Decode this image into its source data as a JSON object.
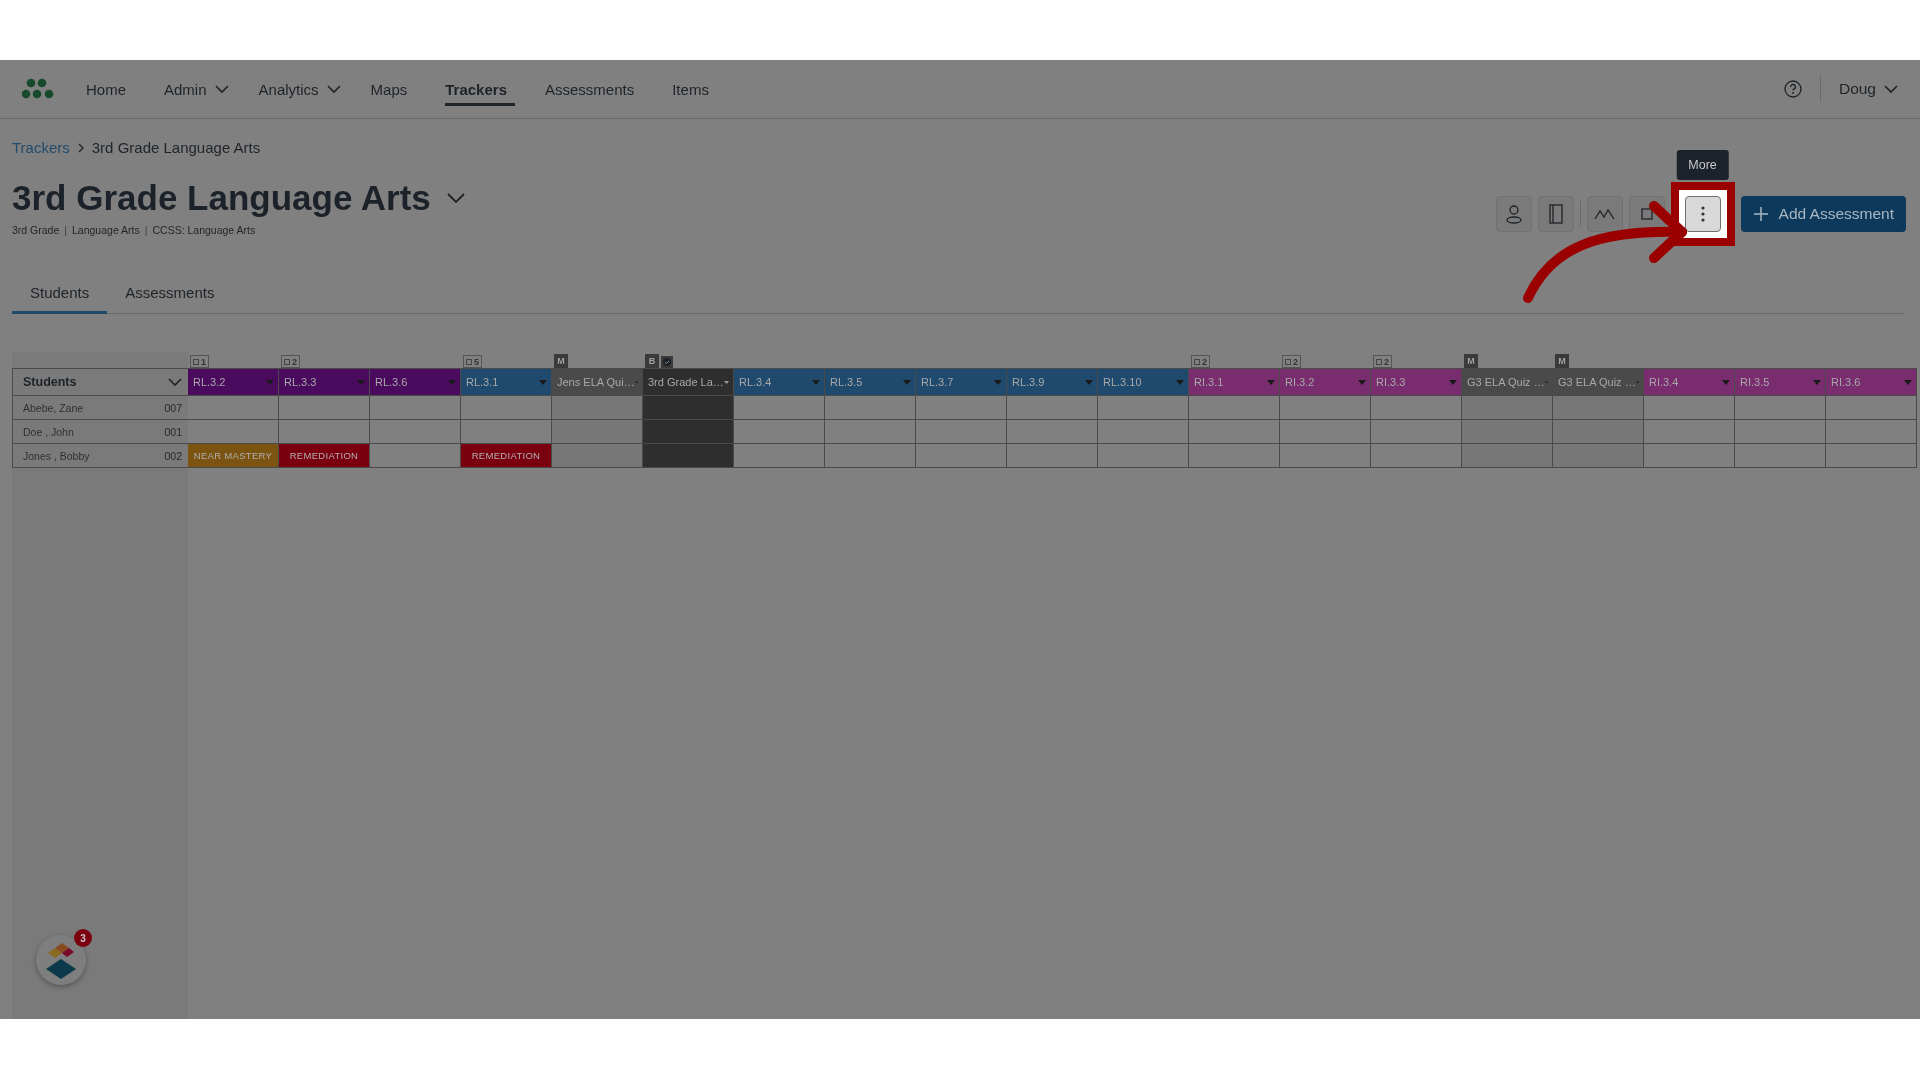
{
  "nav": {
    "items": [
      {
        "label": "Home",
        "dropdown": false,
        "selected": false
      },
      {
        "label": "Admin",
        "dropdown": true,
        "selected": false
      },
      {
        "label": "Analytics",
        "dropdown": true,
        "selected": false
      },
      {
        "label": "Maps",
        "dropdown": false,
        "selected": false
      },
      {
        "label": "Trackers",
        "dropdown": false,
        "selected": true
      },
      {
        "label": "Assessments",
        "dropdown": false,
        "selected": false
      },
      {
        "label": "Items",
        "dropdown": false,
        "selected": false
      }
    ],
    "user": "Doug"
  },
  "breadcrumb": [
    "Trackers",
    "3rd Grade Language Arts"
  ],
  "title": "3rd Grade Language Arts",
  "subtitle": [
    {
      "kind": "tag",
      "text": "3rd Grade"
    },
    {
      "kind": "separator",
      "text": "|"
    },
    {
      "kind": "tag",
      "text": "Language Arts"
    },
    {
      "kind": "separator",
      "text": "|"
    },
    {
      "kind": "tag",
      "text": "CCSS: Language Arts"
    }
  ],
  "toolbar": {
    "tooltip": "More",
    "more_highlighted": true,
    "add_button": "Add Assessment"
  },
  "tabs": [
    {
      "label": "Students",
      "selected": true
    },
    {
      "label": "Assessments",
      "selected": false
    }
  ],
  "table": {
    "student_header": "Students",
    "columns": [
      {
        "label": "RL.3.2",
        "color": "#4a0a5e",
        "kind": "standard",
        "badge": {
          "kind": "count",
          "text": "1"
        }
      },
      {
        "label": "RL.3.3",
        "color": "#4a0a5e",
        "kind": "standard",
        "badge": {
          "kind": "count",
          "text": "2"
        }
      },
      {
        "label": "RL.3.6",
        "color": "#4a0a5e",
        "kind": "standard"
      },
      {
        "label": "RL.3.1",
        "color": "#1f4a6e",
        "kind": "standard",
        "badge": {
          "kind": "count",
          "text": "5"
        }
      },
      {
        "label": "Jens ELA Qui…",
        "color": "#4a4a4a",
        "kind": "quiz",
        "badge": {
          "kind": "letter",
          "text": "M"
        }
      },
      {
        "label": "3rd Grade La…",
        "color": "#2e2e2e",
        "kind": "benchmark",
        "badge": {
          "kind": "verified",
          "text": "B"
        }
      },
      {
        "label": "RL.3.4",
        "color": "#1f4a6e",
        "kind": "standard"
      },
      {
        "label": "RL.3.5",
        "color": "#1f4a6e",
        "kind": "standard"
      },
      {
        "label": "RL.3.7",
        "color": "#1f4a6e",
        "kind": "standard"
      },
      {
        "label": "RL.3.9",
        "color": "#1f4a6e",
        "kind": "standard"
      },
      {
        "label": "RL.3.10",
        "color": "#1f4a6e",
        "kind": "standard"
      },
      {
        "label": "RI.3.1",
        "color": "#7a2d6e",
        "kind": "standard",
        "badge": {
          "kind": "count",
          "text": "2"
        }
      },
      {
        "label": "RI.3.2",
        "color": "#7a2d6e",
        "kind": "standard",
        "badge": {
          "kind": "count",
          "text": "2"
        }
      },
      {
        "label": "RI.3.3",
        "color": "#7a2d6e",
        "kind": "standard",
        "badge": {
          "kind": "count",
          "text": "2"
        }
      },
      {
        "label": "G3 ELA Quiz …",
        "color": "#4a4a4a",
        "kind": "quiz",
        "badge": {
          "kind": "letter",
          "text": "M"
        }
      },
      {
        "label": "G3 ELA Quiz …",
        "color": "#4a4a4a",
        "kind": "quiz",
        "badge": {
          "kind": "letter",
          "text": "M"
        }
      },
      {
        "label": "RI.3.4",
        "color": "#7a2d6e",
        "kind": "standard"
      },
      {
        "label": "RI.3.5",
        "color": "#7a2d6e",
        "kind": "standard"
      },
      {
        "label": "RI.3.6",
        "color": "#7a2d6e",
        "kind": "standard"
      }
    ],
    "rows": [
      {
        "name": "Abebe, Zane",
        "id": "007",
        "cells": [
          {},
          {},
          {},
          {},
          {},
          {},
          {},
          {},
          {},
          {},
          {},
          {},
          {},
          {},
          {},
          {},
          {},
          {},
          {}
        ]
      },
      {
        "name": "Doe , John",
        "id": "001",
        "cells": [
          {},
          {},
          {},
          {},
          {},
          {},
          {},
          {},
          {},
          {},
          {},
          {},
          {},
          {},
          {},
          {},
          {},
          {},
          {}
        ]
      },
      {
        "name": "Jones , Bobby",
        "id": "002",
        "cells": [
          {
            "label": "NEAR MASTERY",
            "color": "#7a5410"
          },
          {
            "label": "REMEDIATION",
            "color": "#7a0010"
          },
          {},
          {
            "label": "REMEDIATION",
            "color": "#7a0010"
          },
          {},
          {},
          {},
          {},
          {},
          {},
          {},
          {},
          {},
          {},
          {},
          {},
          {},
          {},
          {}
        ]
      }
    ]
  },
  "widget": {
    "count": "3"
  }
}
